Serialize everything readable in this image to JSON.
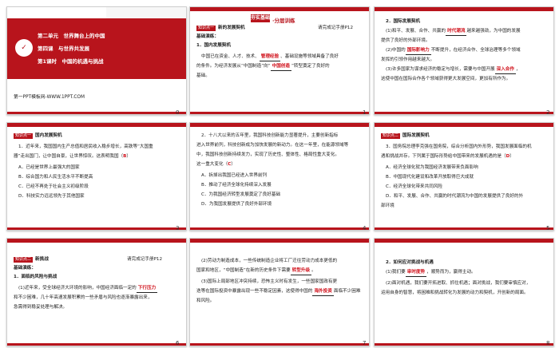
{
  "slides": {
    "s1": {
      "num": "0",
      "lines": [
        "第二单元　世界舞台上的中国",
        "第四课　与世界共发展",
        "第1课时　中国的机遇与挑战"
      ],
      "icon": "✓",
      "footer": "第一PPT模板网-WWW.1PPT.COM"
    },
    "s2": {
      "num": "1",
      "header_badge": "夯实基础",
      "header_title": "·分层训练",
      "tag": "知识点一",
      "title": "新的发展契机",
      "ref": "请完成记手册P12",
      "base": "基础演练：",
      "sub": "1．国内发展契机",
      "p1a": "中国已在资金、人才、技术、",
      "ans1": "管理经验",
      "p1b": "、基础设施等领域具备了良好",
      "p2a": "的条件。为经济发展从“中国制造”向“",
      "ans2": "中国创造",
      "p2b": "”转型奠定了良好的",
      "p3": "基础。"
    },
    "s3": {
      "num": "2",
      "l1": "2．国际发展契机",
      "l2a": "(1)和平、发展、合作、共赢的",
      "ans1": "时代潮流",
      "l2b": "越来越强劲，为中国的发展",
      "l3": "提供了良好的外部环境。",
      "l4a": "(2)中国的",
      "ans2": "国际影响力",
      "l4b": "不断提升，在经济合作、全球治理等多个领域",
      "l5": "发挥的引领作用越来越大。",
      "l6a": "(3)许多国家为谋求经济的稳定与增长，需要与中国开展",
      "ans3": "深入合作",
      "l6b": "，",
      "l7": "这使中国在国际合作各个领域获得更大发展空间，更加有所作为。"
    },
    "s4": {
      "num": "3",
      "tag": "知识点一",
      "title": "国内发展契机",
      "q1": "1．近年来，我国国内生产总值和居民收入稳步增长，高铁等“大国重",
      "q2": "器”走出国门，让中国自豪，让世界惊叹。这表明我国（",
      "ans": "B",
      "q2b": "）",
      "opts": [
        "A．已经是世界上最强大的国家",
        "B．综合国力和人民生活水平不断提高",
        "C．已经不再处于社会主义初级阶段",
        "D．科技实力远远领先于其他国家"
      ]
    },
    "s5": {
      "num": "4",
      "q1": "2．十八大以来的五年里，我国科技创新能力显著提升，主要创新指标",
      "q2": "进入世界前列，科技创新成为加快发展的新动力。在这一年里，在能源领域等",
      "q3": "中，我国科技创新持续发力，实现了历史性、整体性、格局性重大变化。",
      "q4a": "这一重大变化（",
      "ans": "C",
      "q4b": "）",
      "opts": [
        "A．拆掉出我国已经进入世界前列",
        "B．推动了经济全球化持续深入发展",
        "C．为我国经济转型发展奠定了良好基础",
        "D．为我国发展提供了良好外部环境"
      ]
    },
    "s6": {
      "num": "5",
      "tag": "知识点二",
      "title": "国际发展契机",
      "q1": "3．国务院总理李克强在国务院，综合分析国内外形势，我国发展面临的机",
      "q2": "遇和挑战并存。下列属于国际形势给中国带来的发展机遇的是（",
      "ans": "D",
      "q2b": "）",
      "opts": [
        "A．经济全球化就为我国经济发展带来负面影响",
        "B．中国现代化建设和改革开放取得巨大成就",
        "C．经济全球化带来共同风险",
        "D．和平、发展、合作、共赢的时代潮流为中国的发展提供了良好的外"
      ],
      "q3": "部环境"
    },
    "s7": {
      "num": "6",
      "tag": "知识点二",
      "title": "新挑战",
      "ref": "请完成记手册P12",
      "base": "基础演练：",
      "sub": "1．面临的风险与挑战",
      "p1a": "(1)近年来，受全球经济大环境的影响，中国经济面临一定的",
      "ans1": "下行压力",
      "p2": "和不少困难，几十年高速发展积累的一些矛盾与风险也逐渐暴露出来，",
      "p3": "急需得到稳妥处理与解决。"
    },
    "s8": {
      "num": "7",
      "p1": "(2)劳动力制造成本，一些传统制造企业将工厂迁往劳动力成本更低的",
      "p2a": "国家和地区，“中国制造”在新的历史条件下需要",
      "ans1": "转型升级",
      "p2b": "。",
      "p3": "(3)国际上局部地区冲突持续，恐怖主义时有发生，一些国家国政有更",
      "p4": "迭等在国际投资中暴露出现一些不稳定因素，这使得中国的",
      "ans2": "海外投资",
      "p4b": "面临不少困难",
      "p5": "和风险。"
    },
    "s9": {
      "num": "8",
      "l1": "2．如何应对挑战与机遇",
      "l2a": "(1)我们要",
      "ans1": "审时度势",
      "l2b": "，顺势而为，赢得主动。",
      "l3": "(2)面对机遇，我们要开拓进取、抓住机遇；面对挑战，我们要审慎应对，",
      "l4": "运用自身的智慧，将困难和挑战转化为发展的动力和契机，开创新的局面。"
    }
  },
  "colors": {
    "accent": "#b8141c",
    "answer": "#d0101a"
  }
}
